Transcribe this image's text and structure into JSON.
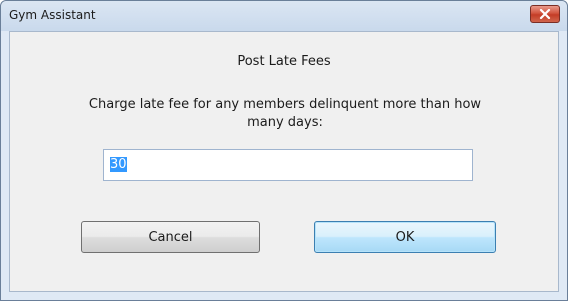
{
  "window": {
    "title": "Gym Assistant"
  },
  "dialog": {
    "heading": "Post Late Fees",
    "prompt": "Charge late fee for any members delinquent more than how many days:",
    "days_value": "30"
  },
  "buttons": {
    "cancel_label": "Cancel",
    "ok_label": "OK"
  },
  "icons": {
    "close": "close-icon"
  },
  "colors": {
    "close_button": "#c43c26",
    "selection": "#3399ff",
    "default_button_border": "#3c7fb1"
  }
}
